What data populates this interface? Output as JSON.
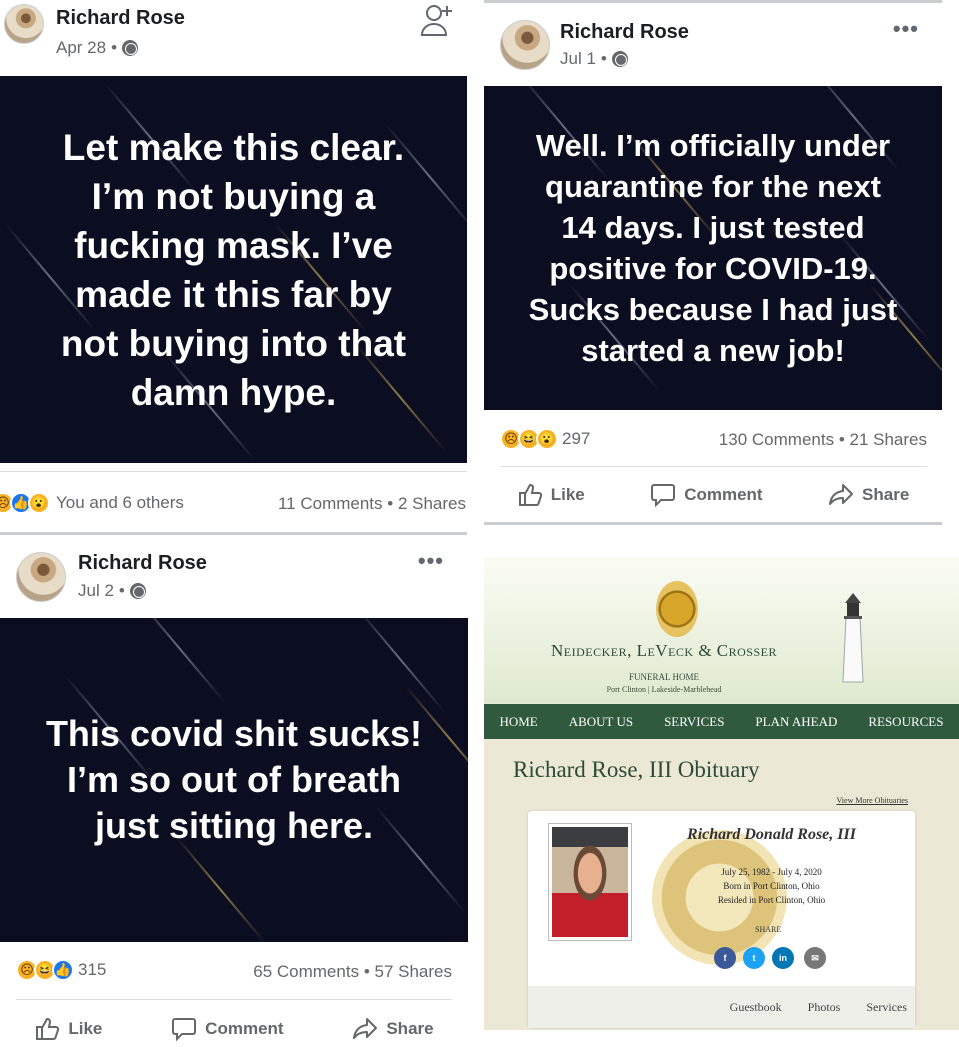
{
  "posts": [
    {
      "author": "Richard Rose",
      "date": "Apr 28",
      "dot": "•",
      "text_lines": [
        "Let make this clear.",
        "I’m not buying a",
        "fucking mask. I’ve",
        "made it this far by",
        "not buying into that",
        "damn hype."
      ],
      "reaction_text": "You and 6 others",
      "comments": "11 Comments",
      "shares": "2 Shares",
      "reactions": [
        "sad-reaction",
        "like-reaction",
        "wow-reaction"
      ]
    },
    {
      "author": "Richard Rose",
      "date": "Jul 1",
      "dot": "•",
      "text_lines": [
        "Well. I’m officially under",
        "quarantine for the next",
        "14 days. I just tested",
        "positive for COVID-19.",
        "Sucks because I had just",
        "started a new job!"
      ],
      "reaction_count": "297",
      "comments": "130 Comments",
      "shares": "21 Shares",
      "reactions": [
        "sad-reaction",
        "haha-reaction",
        "wow-reaction"
      ]
    },
    {
      "author": "Richard Rose",
      "date": "Jul 2",
      "dot": "•",
      "text_lines": [
        "This covid shit sucks!",
        "I’m so out of breath",
        "just sitting here."
      ],
      "reaction_count": "315",
      "comments": "65 Comments",
      "shares": "57 Shares",
      "reactions": [
        "sad-reaction",
        "haha-reaction",
        "like-reaction"
      ]
    }
  ],
  "stat_separator": "•",
  "more_menu": "•••",
  "actions": {
    "like": "Like",
    "comment": "Comment",
    "share": "Share"
  },
  "obituary": {
    "funeral_home": "Neidecker, LeVeck & Crosser",
    "funeral_home_sub": "FUNERAL HOME",
    "locations": "Port Clinton | Lakeside-Marblehead",
    "nav": [
      "HOME",
      "ABOUT US",
      "SERVICES",
      "PLAN AHEAD",
      "RESOURCES"
    ],
    "title": "Richard Rose, III Obituary",
    "view_more": "View More Obituaries",
    "full_name": "Richard Donald Rose, III",
    "dates": "July 25, 1982 - July 4, 2020",
    "born": "Born in Port Clinton, Ohio",
    "resided": "Resided in Port Clinton, Ohio",
    "share": "SHARE",
    "social": [
      "f",
      "t",
      "in",
      "✉"
    ],
    "footer_links": [
      "Guestbook",
      "Photos",
      "Services"
    ]
  },
  "colors": {
    "fb_blue": "#1877f2",
    "post_bg": "#0b0d21",
    "nav_green": "#2f5a3d",
    "meta_gray": "#65676b"
  }
}
